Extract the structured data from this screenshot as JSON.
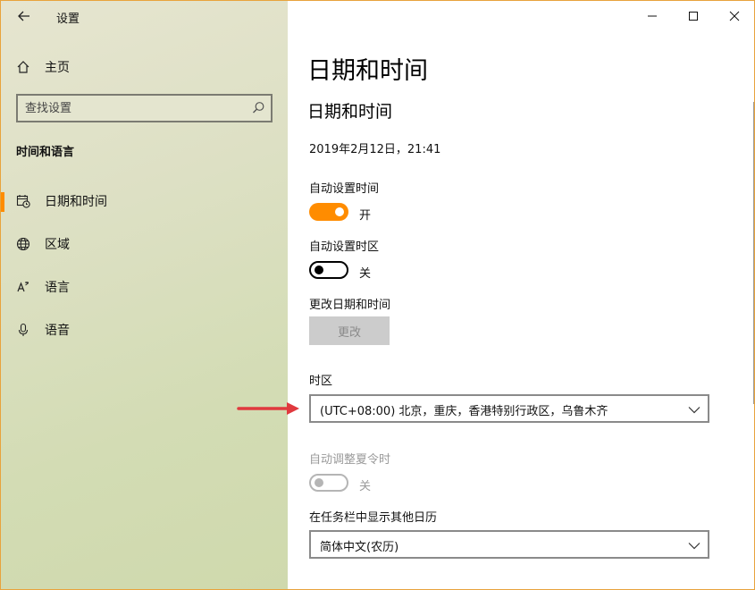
{
  "window": {
    "app_title": "设置",
    "controls": [
      "minimize",
      "maximize",
      "close"
    ]
  },
  "sidebar": {
    "home_label": "主页",
    "search": {
      "placeholder": "查找设置"
    },
    "section_title": "时间和语言",
    "items": [
      {
        "label": "日期和时间",
        "icon": "calendar-clock-icon",
        "active": true
      },
      {
        "label": "区域",
        "icon": "globe-icon",
        "active": false
      },
      {
        "label": "语言",
        "icon": "language-icon",
        "active": false
      },
      {
        "label": "语音",
        "icon": "microphone-icon",
        "active": false
      }
    ]
  },
  "main": {
    "page_title": "日期和时间",
    "sub_title": "日期和时间",
    "current_datetime": "2019年2月12日，21:41",
    "auto_time": {
      "label": "自动设置时间",
      "state": "开",
      "on": true
    },
    "auto_timezone": {
      "label": "自动设置时区",
      "state": "关",
      "on": false
    },
    "change_datetime": {
      "label": "更改日期和时间",
      "button": "更改"
    },
    "timezone": {
      "label": "时区",
      "value": "(UTC+08:00) 北京，重庆，香港特别行政区，乌鲁木齐"
    },
    "dst": {
      "label": "自动调整夏令时",
      "state": "关",
      "disabled": true
    },
    "calendar": {
      "label": "在任务栏中显示其他日历",
      "value": "简体中文(农历)"
    }
  },
  "colors": {
    "accent": "#ff8c00",
    "annotation_arrow": "#e0393e"
  }
}
